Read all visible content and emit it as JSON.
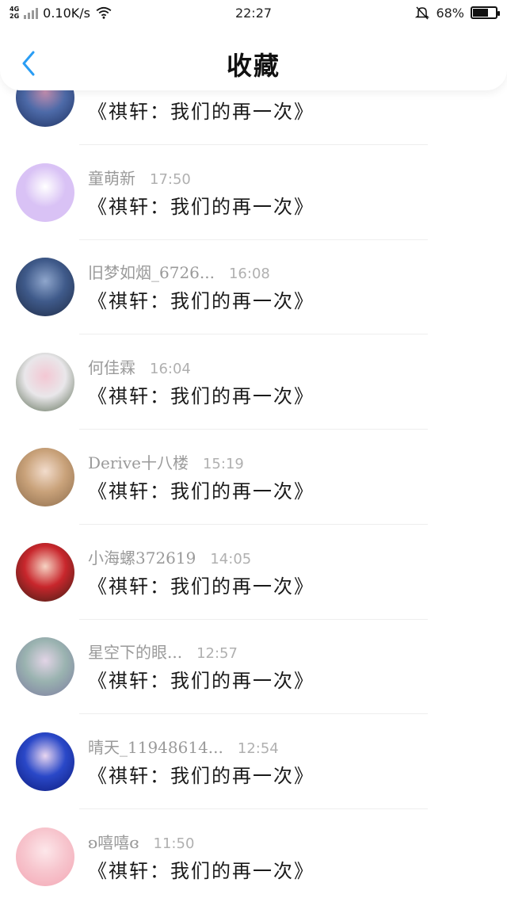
{
  "status_bar": {
    "net_top": "4G",
    "net_bottom": "2G",
    "speed": "0.10K/s",
    "time": "22:27",
    "battery_pct": "68%",
    "battery_level": 0.68
  },
  "nav": {
    "title": "收藏",
    "back_icon": "chevron-left-icon",
    "accent_color": "#2a9df4"
  },
  "items": [
    {
      "username": "",
      "time": "",
      "message": "《祺轩：我们的再一次》",
      "avatar_colors": [
        "#1d2f5e",
        "#4d6aa8",
        "#c58fb0"
      ]
    },
    {
      "username": "童萌新",
      "time": "17:50",
      "message": "《祺轩：我们的再一次》",
      "avatar_colors": [
        "#d9c2f5",
        "#d9c2f5",
        "#ffffff"
      ]
    },
    {
      "username": "旧梦如烟_6726...",
      "time": "16:08",
      "message": "《祺轩：我们的再一次》",
      "avatar_colors": [
        "#1e2a44",
        "#3f5a8a",
        "#8fa6cc"
      ]
    },
    {
      "username": "何佳霖",
      "time": "16:04",
      "message": "《祺轩：我们的再一次》",
      "avatar_colors": [
        "#5a6b52",
        "#e9e7ea",
        "#f3c7d3"
      ]
    },
    {
      "username": "Derive十八楼",
      "time": "15:19",
      "message": "《祺轩：我们的再一次》",
      "avatar_colors": [
        "#8a6a4a",
        "#c9a27a",
        "#f2dccc"
      ]
    },
    {
      "username": "小海螺372619",
      "time": "14:05",
      "message": "《祺轩：我们的再一次》",
      "avatar_colors": [
        "#3a1e14",
        "#c8262c",
        "#f6d3c3"
      ]
    },
    {
      "username": "星空下的眼...",
      "time": "12:57",
      "message": "《祺轩：我们的再一次》",
      "avatar_colors": [
        "#7c7aa0",
        "#9ab3b0",
        "#e2d4e6"
      ]
    },
    {
      "username": "晴天_11948614...",
      "time": "12:54",
      "message": "《祺轩：我们的再一次》",
      "avatar_colors": [
        "#0c1a7a",
        "#2a48c8",
        "#e9d6f0"
      ]
    },
    {
      "username": "ʚ嘻嘻ɞ",
      "time": "11:50",
      "message": "《祺轩：我们的再一次》",
      "avatar_colors": [
        "#f3a6b4",
        "#f7c6ce",
        "#fde7ea"
      ]
    }
  ]
}
